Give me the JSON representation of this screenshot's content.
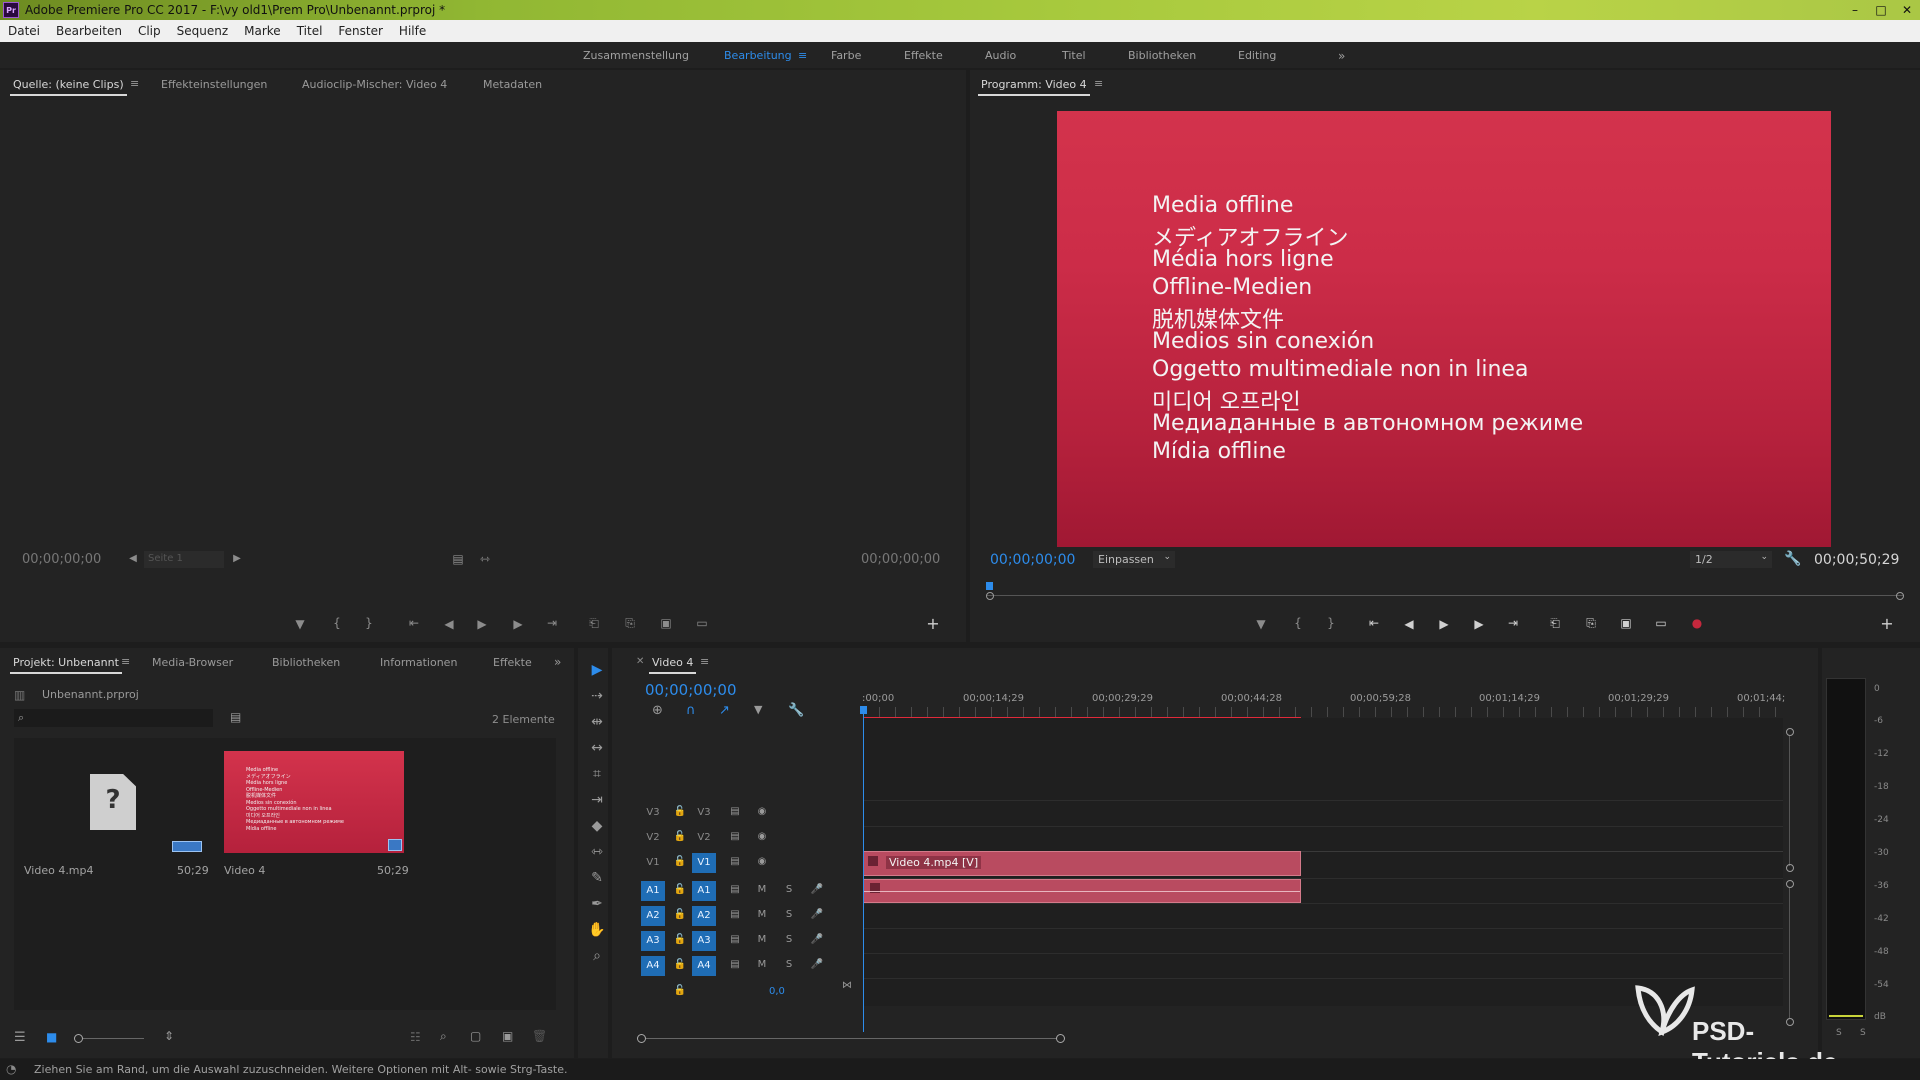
{
  "window": {
    "title": "Adobe Premiere Pro CC 2017 - F:\\vy old1\\Prem Pro\\Unbenannt.prproj *"
  },
  "menu": [
    "Datei",
    "Bearbeiten",
    "Clip",
    "Sequenz",
    "Marke",
    "Titel",
    "Fenster",
    "Hilfe"
  ],
  "workspaces": {
    "items": [
      "Zusammenstellung",
      "Bearbeitung",
      "Farbe",
      "Effekte",
      "Audio",
      "Titel",
      "Bibliotheken",
      "Editing"
    ],
    "active": "Bearbeitung"
  },
  "source_panel": {
    "tabs": [
      "Quelle: (keine Clips)",
      "Effekteinstellungen",
      "Audioclip-Mischer: Video 4",
      "Metadaten"
    ],
    "timecode_left": "00;00;00;00",
    "page_select": "Seite 1",
    "timecode_right": "00;00;00;00"
  },
  "program_panel": {
    "tab": "Programm: Video 4",
    "offline_lines": [
      "Media offline",
      "メディアオフライン",
      "Média hors ligne",
      "Offline-Medien",
      "脱机媒体文件",
      "Medios sin conexión",
      "Oggetto multimediale non in linea",
      "미디어 오프라인",
      "Медиаданные в автономном режиме",
      "Mídia offline"
    ],
    "timecode": "00;00;00;00",
    "zoom": "Einpassen",
    "resolution": "1/2",
    "duration": "00;00;50;29"
  },
  "project_panel": {
    "tabs": [
      "Projekt: Unbenannt",
      "Media-Browser",
      "Bibliotheken",
      "Informationen",
      "Effekte"
    ],
    "file": "Unbenannt.prproj",
    "count": "2 Elemente",
    "items": [
      {
        "name": "Video 4.mp4",
        "duration": "50;29"
      },
      {
        "name": "Video 4",
        "duration": "50;29"
      }
    ],
    "thumb_lines": [
      "Media offline",
      "メディアオフライン",
      "Média hors ligne",
      "Offline-Medien",
      "脱机媒体文件",
      "Medios sin conexión",
      "Oggetto multimediale non in linea",
      "미디어 오프라인",
      "Медиаданные в автономном режиме",
      "Mídia offline"
    ]
  },
  "timeline": {
    "tab": "Video 4",
    "timecode": "00;00;00;00",
    "ruler": [
      ":00;00",
      "00;00;14;29",
      "00;00;29;29",
      "00;00;44;28",
      "00;00;59;28",
      "00;01;14;29",
      "00;01;29;29",
      "00;01;44;"
    ],
    "video_tracks": [
      "V3",
      "V2",
      "V1"
    ],
    "audio_tracks": [
      "A1",
      "A2",
      "A3",
      "A4"
    ],
    "clip_label": "Video 4.mp4 [V]",
    "mix_value": "0,0",
    "mute": "M",
    "solo": "S"
  },
  "meter": {
    "scale": [
      "0",
      "-6",
      "-12",
      "-18",
      "-24",
      "-30",
      "-36",
      "-42",
      "-48",
      "-54",
      "dB"
    ],
    "bottom": [
      "S",
      "S"
    ]
  },
  "status": {
    "text": "Ziehen Sie am Rand, um die Auswahl zuzuschneiden. Weitere Optionen mit Alt- sowie Strg-Taste."
  },
  "watermark": {
    "text": "PSD-Tutorials.de"
  },
  "colors": {
    "accent": "#2d8ceb",
    "clip": "#b94b60",
    "offline": "#c92a45",
    "playhead": "#2d8ceb",
    "workarea": "#e02a3a"
  }
}
